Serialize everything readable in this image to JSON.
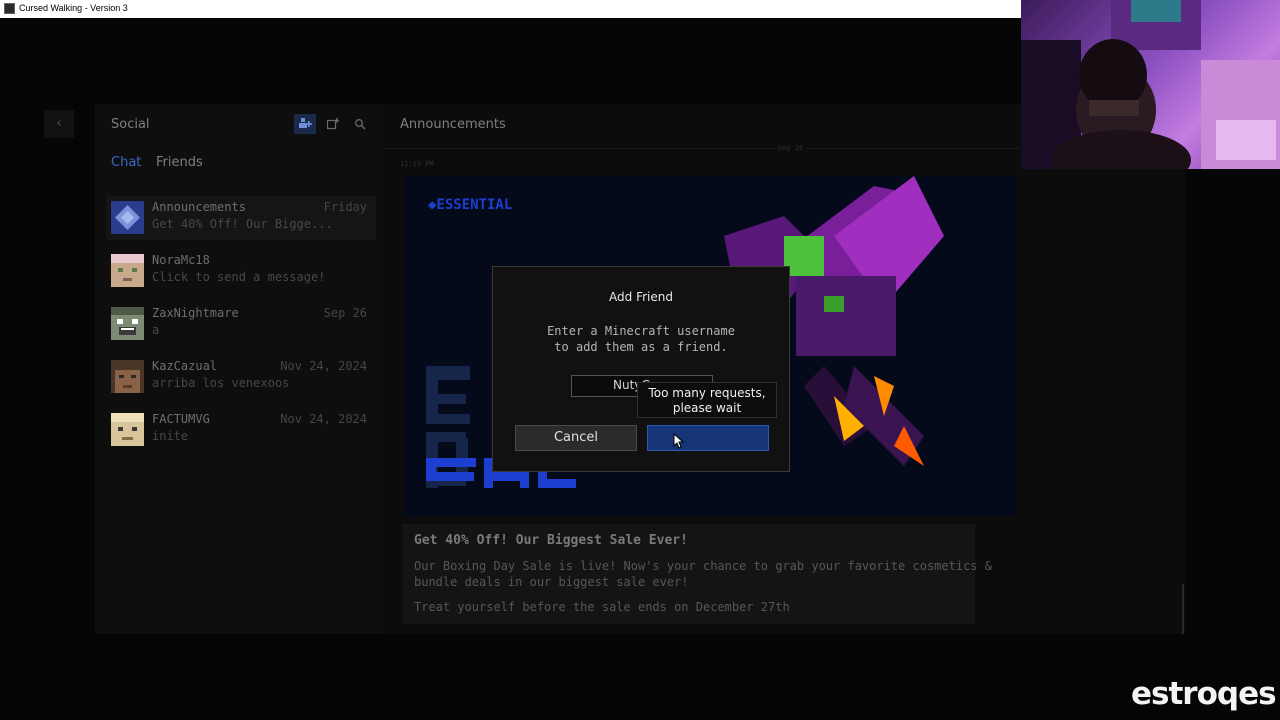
{
  "window": {
    "title": "Cursed Walking - Version 3"
  },
  "social": {
    "title": "Social",
    "header_icons": [
      "add-friend-icon",
      "new-group-icon",
      "search-icon"
    ],
    "tabs": [
      {
        "label": "Chat",
        "active": true
      },
      {
        "label": "Friends",
        "active": false
      }
    ],
    "conversations": [
      {
        "name": "Announcements",
        "preview": "Get 40% Off! Our Bigge...",
        "date": "Friday"
      },
      {
        "name": "NoraMc18",
        "preview": "Click to send a message!",
        "date": ""
      },
      {
        "name": "ZaxNightmare",
        "preview": "a",
        "date": "Sep 26"
      },
      {
        "name": "KazCazual",
        "preview": "arriba los venexoos",
        "date": "Nov 24, 2024"
      },
      {
        "name": "FACTUMVG",
        "preview": "inite",
        "date": "Nov 24, 2024"
      }
    ]
  },
  "main": {
    "title": "Announcements",
    "date_divider": "Sep 26",
    "time": "11:19 PM",
    "banner_brand": "◆ESSENTIAL",
    "card": {
      "heading": "Get 40% Off! Our Biggest Sale Ever!",
      "line1": "Our Boxing Day Sale is live! Now's your chance to grab your favorite cosmetics &",
      "line2": "bundle deals in our biggest sale ever!",
      "line3": "Treat yourself before the sale ends on December 27th"
    }
  },
  "modal": {
    "title": "Add Friend",
    "desc_line1": "Enter a Minecraft username",
    "desc_line2": "to add them as a friend.",
    "input_value": "NutyG",
    "cancel_label": "Cancel",
    "add_label": "",
    "tooltip_line1": "Too many requests,",
    "tooltip_line2": "please wait"
  },
  "overlay": {
    "watermark": "estroqes"
  },
  "colors": {
    "accent": "#163578",
    "accent_text": "#6f8fd8",
    "brand": "#1d3fd0",
    "wing": "#8a2bb5"
  }
}
